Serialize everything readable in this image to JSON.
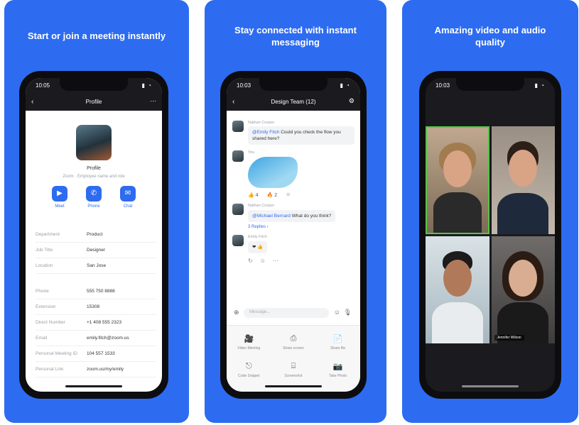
{
  "panels": [
    {
      "headline": "Start or join a meeting instantly"
    },
    {
      "headline": "Stay connected with instant messaging"
    },
    {
      "headline": "Amazing video and audio quality"
    }
  ],
  "phone1": {
    "status_time": "10:05",
    "status_icons": "▮ ◔",
    "title": "Profile",
    "name": "Profile",
    "subtitle": "Zoom · Employee name and role",
    "actions": [
      {
        "icon": "video-icon",
        "label": "Meet"
      },
      {
        "icon": "phone-icon",
        "label": "Phone"
      },
      {
        "icon": "chat-icon",
        "label": "Chat"
      }
    ],
    "details": [
      {
        "key": "Department",
        "value": "Product"
      },
      {
        "key": "Job Title",
        "value": "Designer"
      },
      {
        "key": "Location",
        "value": "San Jose"
      },
      {
        "key": "Phone",
        "value": "555 750 8888"
      },
      {
        "key": "Extension",
        "value": "15308"
      },
      {
        "key": "Direct Number",
        "value": "+1 408 555 2323"
      },
      {
        "key": "Email",
        "value": "emily.fitch@zoom.us"
      },
      {
        "key": "Personal Meeting ID",
        "value": "104 557 1533"
      },
      {
        "key": "Personal Link",
        "value": "zoom.us/my/emily"
      }
    ]
  },
  "phone2": {
    "status_time": "10:03",
    "status_icons": "▮ ◔",
    "title": "Design Team (12)",
    "messages": [
      {
        "sender": "Nathan Cooper",
        "mention": "@Emily Fitch",
        "text": " Could you check the flow you shared here?"
      },
      {
        "sender": "You",
        "image": true,
        "reactions": [
          "👍 4",
          "🔥 2",
          "☺"
        ]
      },
      {
        "sender": "Nathan Cooper",
        "mention": "@Michael Bernard",
        "text": " What do you think?",
        "replies": "3 Replies  ›"
      },
      {
        "sender": "Emily Fitch",
        "text": "❤ 👍",
        "tools": [
          "↻",
          "☺",
          "⋯"
        ]
      }
    ],
    "composer_placeholder": "Message...",
    "tray": [
      {
        "icon": "🎥",
        "label": "Video Meeting"
      },
      {
        "icon": "⎙",
        "label": "Share screen"
      },
      {
        "icon": "📄",
        "label": "Share file"
      },
      {
        "icon": "⎋",
        "label": "Code Snippet"
      },
      {
        "icon": "⌸",
        "label": "Screenshot"
      },
      {
        "icon": "📷",
        "label": "Take Photo"
      }
    ]
  },
  "phone3": {
    "status_time": "10:03",
    "status_icons": "▮ ◔",
    "tiles": [
      {
        "name": ""
      },
      {
        "name": ""
      },
      {
        "name": ""
      },
      {
        "name": "Jennifer Wilson"
      }
    ]
  }
}
